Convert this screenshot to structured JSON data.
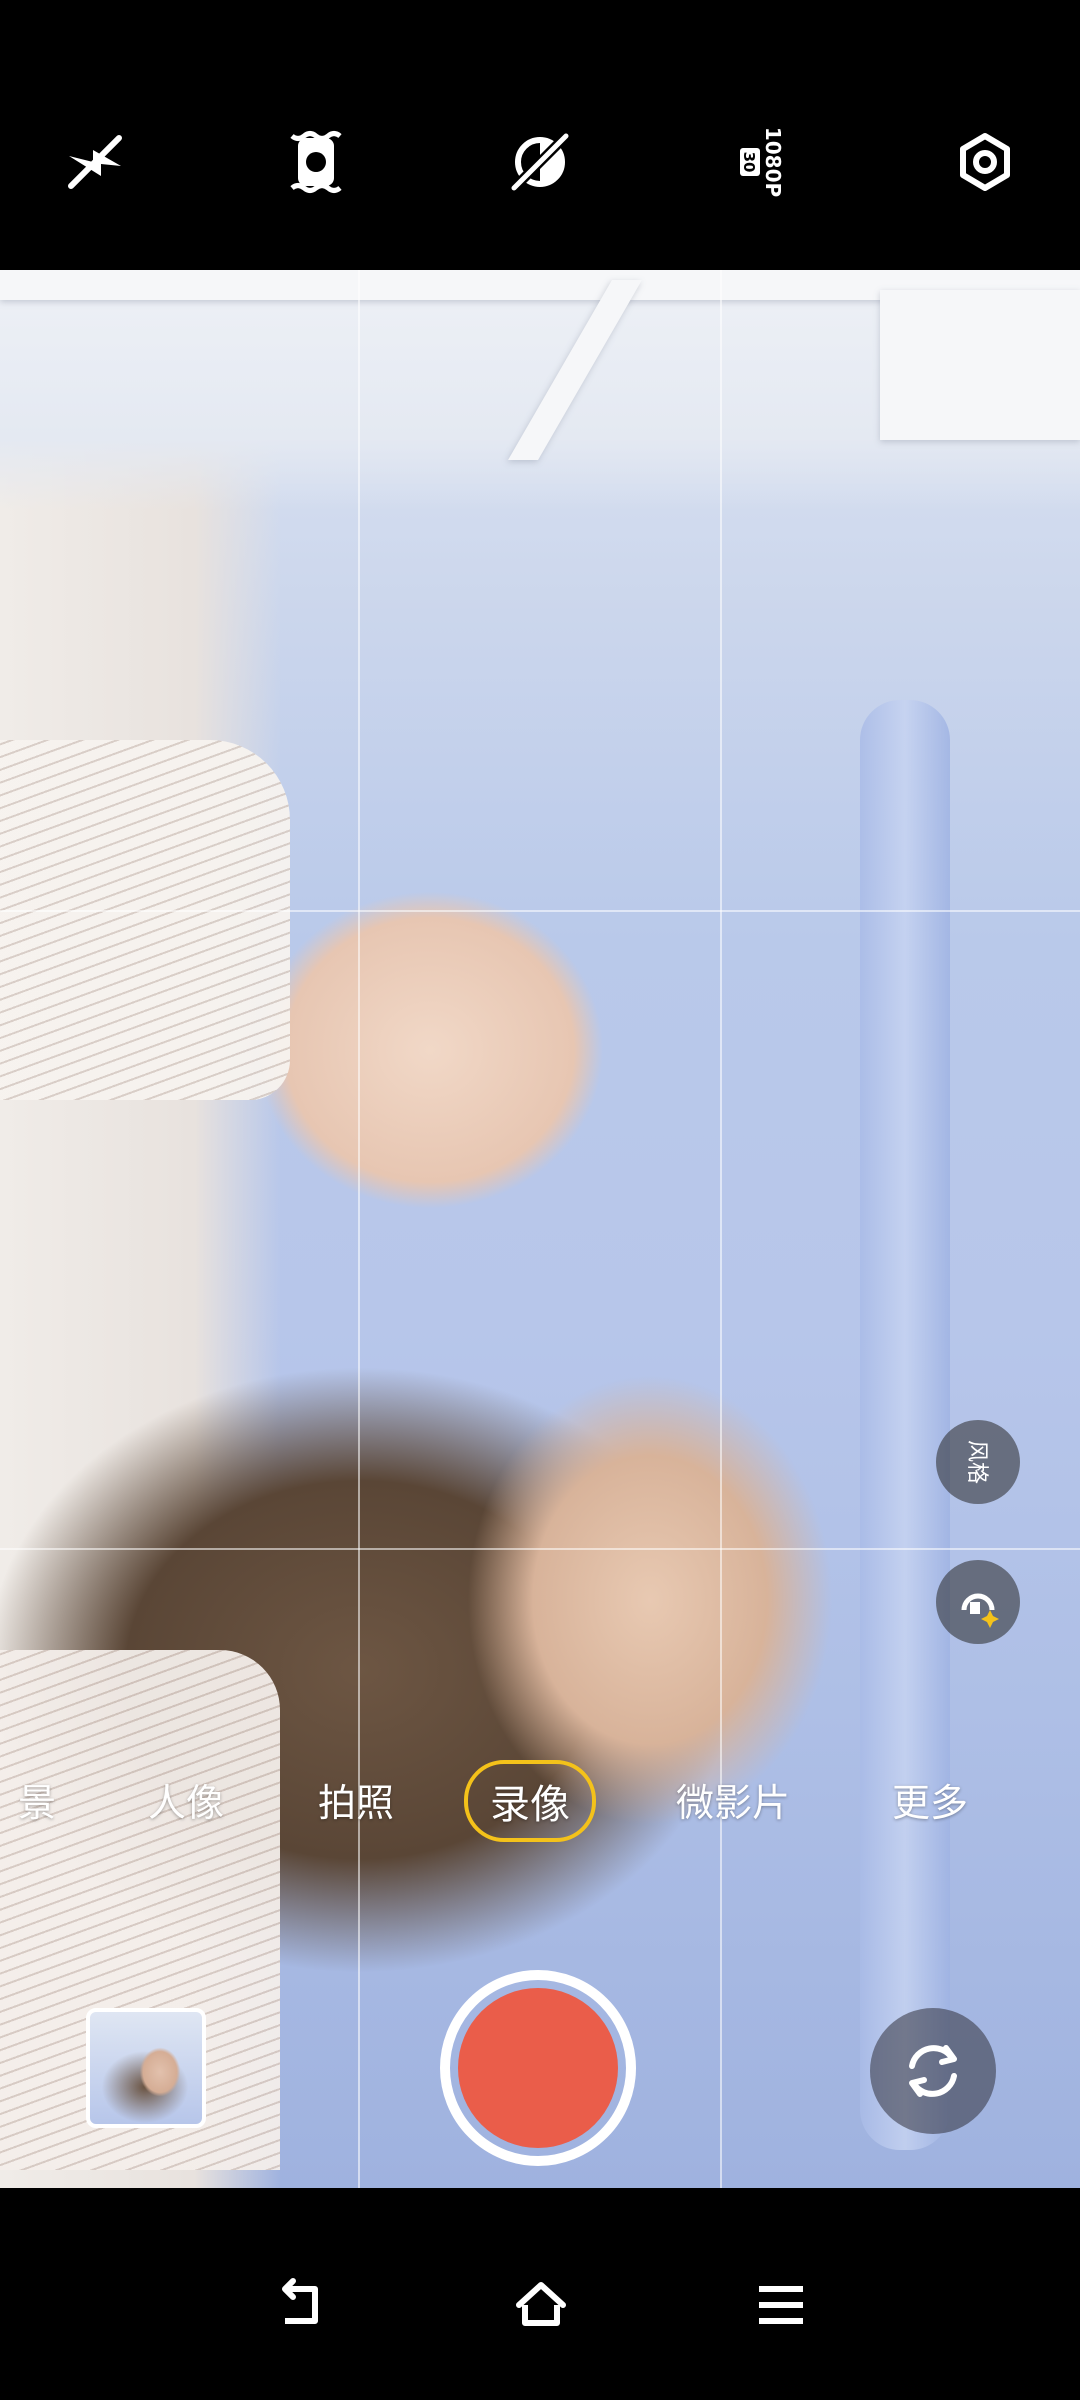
{
  "top_bar": {
    "icons": [
      {
        "name": "flash-off-icon"
      },
      {
        "name": "stabilization-icon"
      },
      {
        "name": "filter-off-icon"
      },
      {
        "name": "resolution-icon",
        "label": "1080P",
        "sub": "30"
      },
      {
        "name": "settings-icon"
      }
    ]
  },
  "viewfinder": {
    "side_buttons": [
      {
        "name": "style-button",
        "label": "风格"
      },
      {
        "name": "beauty-button"
      }
    ]
  },
  "modes": {
    "items": [
      {
        "label": "景"
      },
      {
        "label": "人像"
      },
      {
        "label": "拍照"
      },
      {
        "label": "录像",
        "active": true
      },
      {
        "label": "微影片"
      },
      {
        "label": "更多"
      }
    ]
  },
  "controls": {
    "shutter_color": "#ea5d4a",
    "accent_color": "#f4c21a"
  },
  "nav": {
    "items": [
      "back-icon",
      "home-icon",
      "menu-icon"
    ]
  }
}
